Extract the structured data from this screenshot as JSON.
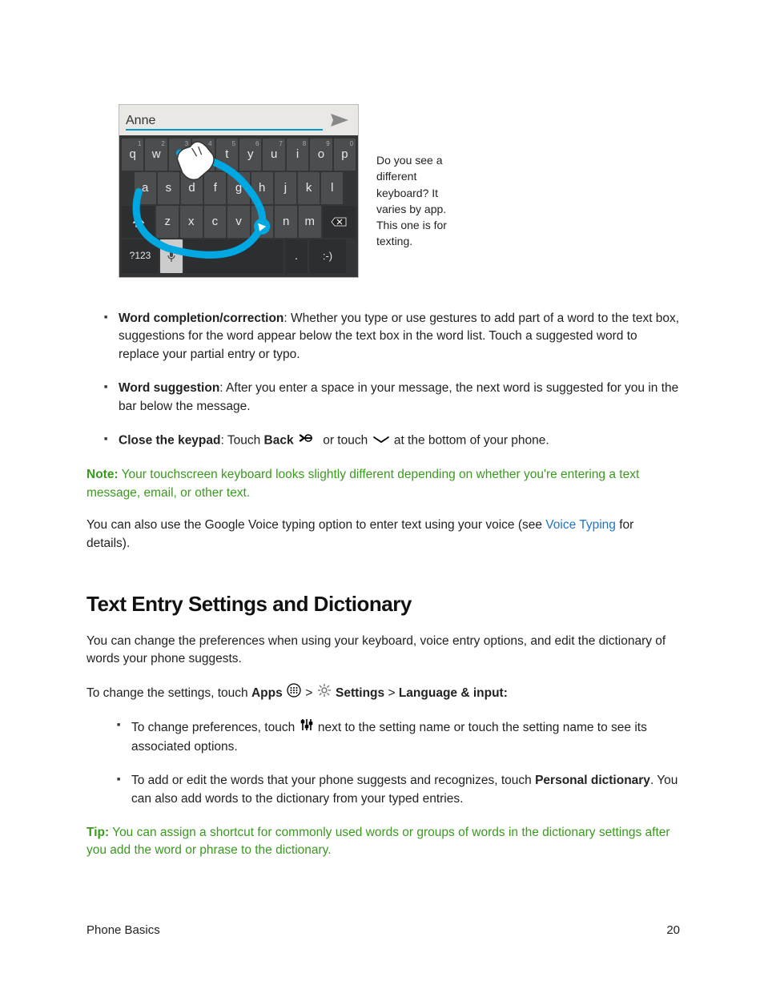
{
  "keyboard": {
    "typed": "Anne",
    "caption": "Do you see a different keyboard? It varies by app. This one is for texting.",
    "row1": [
      {
        "k": "q",
        "s": "1"
      },
      {
        "k": "w",
        "s": "2"
      },
      {
        "k": "e",
        "s": "3"
      },
      {
        "k": "r",
        "s": "4"
      },
      {
        "k": "t",
        "s": "5"
      },
      {
        "k": "y",
        "s": "6"
      },
      {
        "k": "u",
        "s": "7"
      },
      {
        "k": "i",
        "s": "8"
      },
      {
        "k": "o",
        "s": "9"
      },
      {
        "k": "p",
        "s": "0"
      }
    ],
    "row2": [
      "a",
      "s",
      "d",
      "f",
      "g",
      "h",
      "j",
      "k",
      "l"
    ],
    "row3": [
      "z",
      "x",
      "c",
      "v",
      "b",
      "n",
      "m"
    ],
    "sym_key": "?123",
    "smile_key": ":-)",
    "period_key": "."
  },
  "bullets": [
    {
      "term": "Word completion/correction",
      "text": ": Whether you type or use gestures to add part of a word to the text box, suggestions for the word appear below the text box in the word list. Touch a suggested word to replace your partial entry or typo."
    },
    {
      "term": "Word suggestion",
      "text": ": After you enter a space in your message, the next word is suggested for you in the bar below the message."
    },
    {
      "term": "Close the keypad",
      "text_pre": ": Touch ",
      "back_label": "Back",
      "text_mid": " or touch ",
      "text_post": " at the bottom of your phone."
    }
  ],
  "note": {
    "label": "Note:",
    "text": " Your touchscreen keyboard looks slightly different depending on whether you're entering a text message, email, or other text."
  },
  "voice_para": {
    "pre": "You can also use the Google Voice typing option to enter text using your voice (see ",
    "link": "Voice Typing",
    "post": " for details)."
  },
  "section_heading": "Text Entry Settings and Dictionary",
  "section_intro": "You can change the preferences when using your keyboard, voice entry options, and edit the dictionary of words your phone suggests.",
  "settings_path": {
    "pre": "To change the settings, touch ",
    "apps": "Apps",
    "gt1": " > ",
    "settings": "Settings",
    "gt2": " > ",
    "lang": "Language & input:"
  },
  "settings_bullets": [
    {
      "pre": "To change preferences, touch ",
      "post": " next to the setting name or touch the setting name to see its associated options."
    },
    {
      "pre": "To add or edit the words that your phone suggests and recognizes, touch ",
      "bold": "Personal dictionary",
      "post": ". You can also add words to the dictionary from your typed entries."
    }
  ],
  "tip": {
    "label": "Tip:",
    "text": " You can assign a shortcut for commonly used words or groups of words in the dictionary settings after you add the word or phrase to the dictionary."
  },
  "footer": {
    "left": "Phone Basics",
    "right": "20"
  }
}
